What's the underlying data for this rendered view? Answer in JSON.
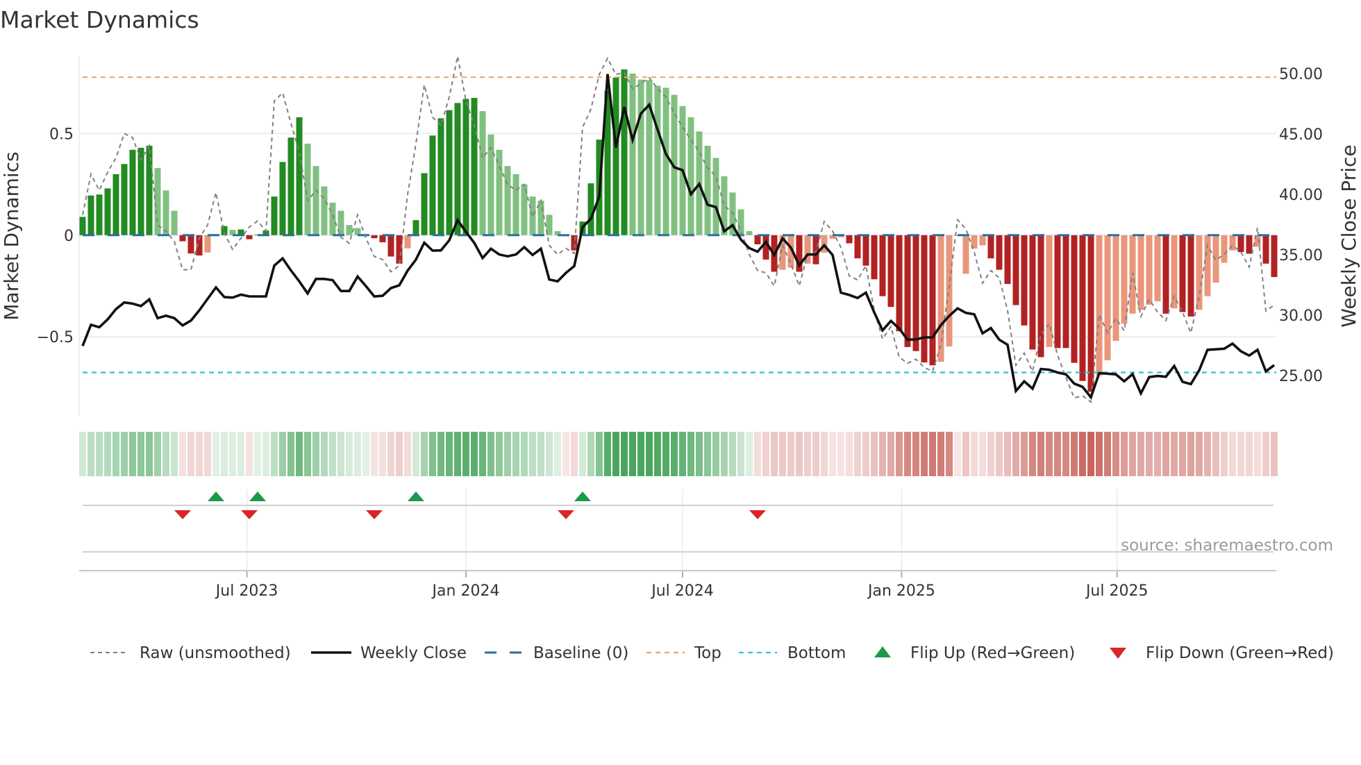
{
  "chart_data": {
    "type": "bar",
    "title": "Market Dynamics",
    "ylabel": "Market Dynamics",
    "ylabel_right": "Weekly Close Price",
    "source": "source: sharemaestro.com",
    "frequency": "weekly",
    "start_date": "2023-02-13",
    "ylim": [
      -0.885,
      0.88
    ],
    "ylim_right": [
      21.72,
      51.44
    ],
    "yticks": [
      {
        "value": 0.5,
        "label": "0.5"
      },
      {
        "value": 0,
        "label": "0"
      },
      {
        "value": -0.5,
        "label": "−0.5"
      }
    ],
    "yticks_right": [
      {
        "value": 50,
        "label": "50.00"
      },
      {
        "value": 45,
        "label": "45.00"
      },
      {
        "value": 40,
        "label": "40.00"
      },
      {
        "value": 35,
        "label": "35.00"
      },
      {
        "value": 30,
        "label": "30.00"
      },
      {
        "value": 25,
        "label": "25.00"
      }
    ],
    "xticks": [
      {
        "date": "2023-07-01",
        "label": "Jul 2023"
      },
      {
        "date": "2024-01-01",
        "label": "Jan 2024"
      },
      {
        "date": "2024-07-01",
        "label": "Jul 2024"
      },
      {
        "date": "2025-01-01",
        "label": "Jan 2025"
      },
      {
        "date": "2025-07-01",
        "label": "Jul 2025"
      }
    ],
    "grid": true,
    "legend_position": "bottom",
    "top_level": 0.777,
    "bottom_level": -0.675,
    "baseline": 0,
    "momentum": [
      0.09,
      0.195,
      0.2,
      0.23,
      0.3,
      0.35,
      0.42,
      0.43,
      0.44,
      0.33,
      0.22,
      0.12,
      -0.03,
      -0.09,
      -0.1,
      -0.085,
      0.005,
      0.045,
      0.026,
      0.028,
      -0.02,
      0.003,
      0.023,
      0.19,
      0.36,
      0.48,
      0.58,
      0.45,
      0.34,
      0.24,
      0.16,
      0.12,
      0.05,
      0.035,
      0.003,
      -0.015,
      -0.035,
      -0.105,
      -0.14,
      -0.065,
      0.074,
      0.305,
      0.49,
      0.575,
      0.615,
      0.65,
      0.67,
      0.675,
      0.61,
      0.495,
      0.42,
      0.34,
      0.3,
      0.25,
      0.19,
      0.17,
      0.1,
      0.02,
      -0.005,
      -0.075,
      0.067,
      0.255,
      0.47,
      0.71,
      0.775,
      0.815,
      0.795,
      0.765,
      0.763,
      0.735,
      0.725,
      0.69,
      0.635,
      0.58,
      0.51,
      0.44,
      0.38,
      0.29,
      0.21,
      0.127,
      0.02,
      -0.045,
      -0.12,
      -0.18,
      -0.17,
      -0.16,
      -0.18,
      -0.14,
      -0.143,
      -0.086,
      -0.018,
      -0.01,
      -0.04,
      -0.114,
      -0.15,
      -0.217,
      -0.3,
      -0.353,
      -0.473,
      -0.55,
      -0.57,
      -0.626,
      -0.64,
      -0.623,
      -0.547,
      -0.004,
      -0.19,
      -0.066,
      -0.05,
      -0.114,
      -0.17,
      -0.24,
      -0.344,
      -0.444,
      -0.5625,
      -0.6,
      -0.55,
      -0.555,
      -0.555,
      -0.628,
      -0.717,
      -0.77,
      -0.69,
      -0.615,
      -0.52,
      -0.435,
      -0.386,
      -0.367,
      -0.342,
      -0.325,
      -0.386,
      -0.36,
      -0.378,
      -0.4,
      -0.367,
      -0.3,
      -0.233,
      -0.136,
      -0.075,
      -0.083,
      -0.091,
      -0.057,
      -0.14,
      -0.206
    ],
    "momentum_shade": "DDDDDDDDDLLLDDDLDDLDDDDDDDDLLLLLLLLDDDDLDDDDDDDDLLLLLLLLLLDDDDDDDDLLLLLLLLLLLLLLLDDDLLDLDLLLDDDDDDDDDDDLLLLLLDDDDDDDLDDDDDLLLLLLLLDLDDLLLLLDDLDD",
    "raw": [
      0.1,
      0.3,
      0.22,
      0.31,
      0.38,
      0.5,
      0.48,
      0.37,
      0.44,
      0.05,
      0.02,
      -0.03,
      -0.17,
      -0.17,
      -0.015,
      0.05,
      0.21,
      0.01,
      -0.07,
      -0.015,
      0.04,
      0.07,
      0.02,
      0.66,
      0.7,
      0.55,
      0.41,
      0.17,
      0.22,
      0.18,
      0.1,
      -0.01,
      -0.04,
      0.1,
      -0.015,
      -0.105,
      -0.12,
      -0.18,
      -0.15,
      0.2,
      0.45,
      0.74,
      0.58,
      0.54,
      0.68,
      0.88,
      0.66,
      0.54,
      0.38,
      0.43,
      0.34,
      0.25,
      0.22,
      0.25,
      0.09,
      0.17,
      -0.05,
      -0.095,
      -0.065,
      -0.09,
      0.53,
      0.62,
      0.79,
      0.87,
      0.79,
      0.8,
      0.72,
      0.745,
      0.775,
      0.72,
      0.68,
      0.6,
      0.53,
      0.47,
      0.41,
      0.33,
      0.29,
      0.145,
      0.11,
      0.02,
      -0.094,
      -0.174,
      -0.185,
      -0.25,
      -0.05,
      -0.14,
      -0.25,
      -0.094,
      -0.083,
      0.067,
      0.02,
      -0.06,
      -0.2,
      -0.22,
      -0.15,
      -0.37,
      -0.51,
      -0.45,
      -0.6,
      -0.63,
      -0.61,
      -0.65,
      -0.67,
      -0.54,
      -0.25,
      0.076,
      0.03,
      -0.083,
      -0.236,
      -0.174,
      -0.21,
      -0.37,
      -0.64,
      -0.58,
      -0.67,
      -0.49,
      -0.435,
      -0.59,
      -0.7,
      -0.8,
      -0.79,
      -0.82,
      -0.39,
      -0.48,
      -0.41,
      -0.47,
      -0.185,
      -0.4,
      -0.316,
      -0.378,
      -0.42,
      -0.3,
      -0.378,
      -0.48,
      -0.3,
      -0.05,
      -0.123,
      -0.094,
      -0.05,
      -0.083,
      -0.157,
      0.036,
      -0.373,
      -0.344
    ],
    "weekly_close": [
      27.45,
      29.2,
      29.0,
      29.65,
      30.5,
      31.05,
      30.95,
      30.75,
      31.3,
      29.75,
      29.95,
      29.75,
      29.15,
      29.55,
      30.4,
      31.35,
      32.3,
      31.5,
      31.45,
      31.7,
      31.55,
      31.55,
      31.55,
      34.1,
      34.7,
      33.7,
      32.8,
      31.8,
      33.0,
      33.0,
      32.9,
      32.0,
      32.0,
      33.2,
      32.4,
      31.55,
      31.6,
      32.24,
      32.47,
      33.68,
      34.6,
      36.0,
      35.34,
      35.36,
      36.2,
      37.86,
      36.9,
      35.98,
      34.73,
      35.5,
      35.02,
      34.87,
      35.02,
      35.63,
      34.98,
      35.5,
      32.95,
      32.8,
      33.5,
      34.06,
      37.28,
      37.99,
      39.8,
      49.96,
      43.87,
      47.24,
      44.5,
      46.7,
      47.43,
      45.36,
      43.35,
      42.24,
      42.0,
      40.02,
      40.86,
      39.14,
      38.95,
      36.94,
      37.45,
      36.26,
      35.55,
      35.25,
      36.07,
      34.98,
      36.36,
      35.59,
      34.12,
      35.02,
      35.02,
      35.78,
      34.98,
      31.86,
      31.67,
      31.42,
      31.86,
      30.23,
      28.74,
      29.52,
      28.89,
      27.97,
      27.99,
      28.16,
      28.16,
      29.18,
      29.94,
      30.56,
      30.19,
      30.07,
      28.5,
      28.93,
      27.97,
      27.55,
      23.72,
      24.52,
      23.91,
      25.54,
      25.48,
      25.25,
      25.1,
      24.33,
      24.06,
      23.2,
      25.2,
      25.15,
      25.1,
      24.52,
      25.12,
      23.52,
      24.87,
      24.96,
      24.9,
      25.79,
      24.48,
      24.29,
      25.44,
      27.13,
      27.17,
      27.22,
      27.64,
      27.01,
      26.65,
      27.13,
      25.34,
      25.86
    ],
    "flip_up_dates": [
      "2023-06-05",
      "2023-07-10",
      "2023-11-20",
      "2024-04-08"
    ],
    "flip_down_dates": [
      "2023-05-08",
      "2023-07-03",
      "2023-10-16",
      "2024-03-25",
      "2024-09-02"
    ],
    "legend": [
      {
        "key": "raw",
        "label": "Raw (unsmoothed)"
      },
      {
        "key": "close",
        "label": "Weekly Close"
      },
      {
        "key": "baseline",
        "label": "Baseline (0)"
      },
      {
        "key": "top",
        "label": "Top"
      },
      {
        "key": "bottom",
        "label": "Bottom"
      },
      {
        "key": "flip_up",
        "label": "Flip Up (Red→Green)"
      },
      {
        "key": "flip_down",
        "label": "Flip Down (Green→Red)"
      }
    ],
    "colors": {
      "pos_strong": "#228b22",
      "pos_weak": "#80c080",
      "neg_strong": "#b22222",
      "neg_weak": "#e9967a",
      "raw": "#808080",
      "close": "#111111",
      "baseline": "#2b6f9f",
      "top": "#f4a460",
      "bottom": "#2ec4d6",
      "flip_up": "#1a9a48",
      "flip_down": "#d62728",
      "strip_pos": "#3a9e50",
      "strip_neg": "#c3564e"
    }
  }
}
